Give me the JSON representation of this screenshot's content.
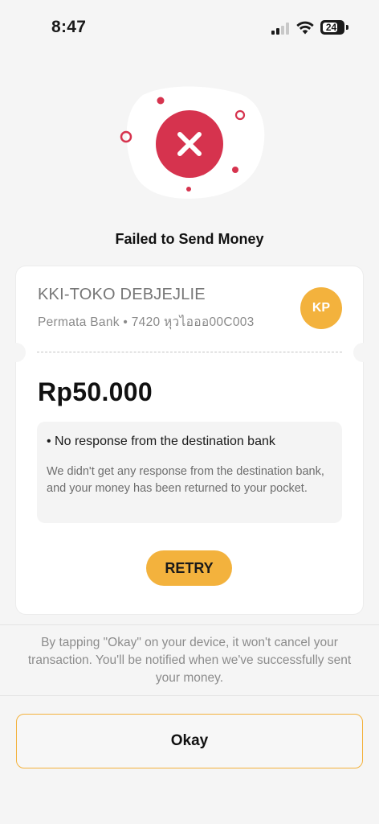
{
  "status_bar": {
    "time": "8:47",
    "battery": "24"
  },
  "title": "Failed to Send Money",
  "recipient": {
    "name": "KKI-TOKO DEBJEJLIE",
    "bank": "Permata Bank • 7420 หุวไอออ00C003",
    "initials": "KP"
  },
  "amount": "Rp50.000",
  "reason": {
    "title": "• No response from the destination bank",
    "description": "We didn't get any response from the destination bank, and your money has been returned to your pocket."
  },
  "retry_label": "RETRY",
  "notice": "By tapping \"Okay\" on your device, it won't cancel your transaction. You'll be notified when we've successfully sent your money.",
  "okay_label": "Okay",
  "colors": {
    "error_red": "#d6334e",
    "accent_yellow": "#f3b23d",
    "background": "#f5f5f5"
  },
  "icons": [
    "signal-icon",
    "wifi-icon",
    "battery-icon",
    "failed-x-icon"
  ]
}
